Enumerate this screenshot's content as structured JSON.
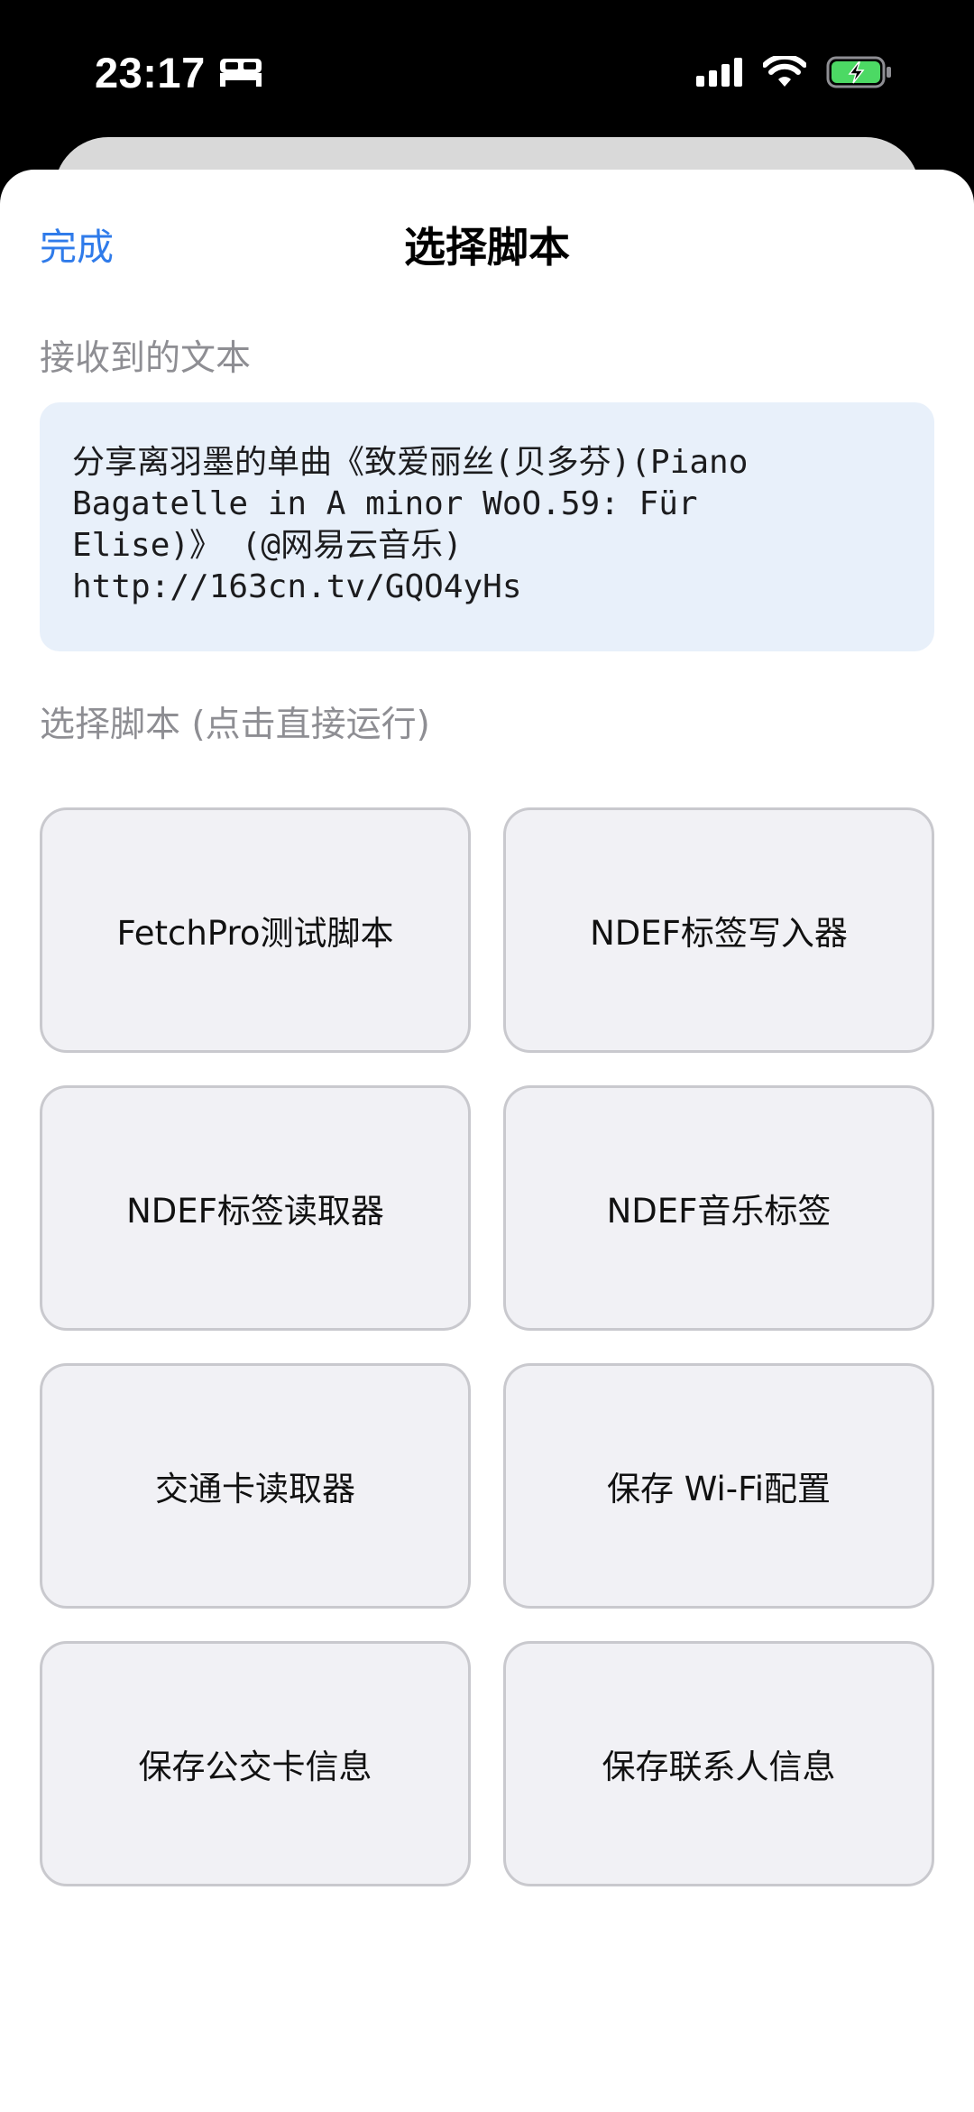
{
  "status_bar": {
    "time": "23:17",
    "icons": [
      "bed-icon",
      "cellular-signal-icon",
      "wifi-icon",
      "battery-charging-icon"
    ],
    "battery_color": "#4cd964"
  },
  "sheet": {
    "done_label": "完成",
    "title": "选择脚本",
    "accent_color": "#2f7bea"
  },
  "received": {
    "label": "接收到的文本",
    "text": "分享离羽墨的单曲《致爱丽丝(贝多芬)(Piano\nBagatelle in A minor WoO.59: Für\nElise)》 (@网易云音乐)\nhttp://163cn.tv/GQO4yHs"
  },
  "scripts": {
    "label": "选择脚本 (点击直接运行)",
    "items": [
      {
        "label": "FetchPro测试脚本"
      },
      {
        "label": "NDEF标签写入器"
      },
      {
        "label": "NDEF标签读取器"
      },
      {
        "label": "NDEF音乐标签"
      },
      {
        "label": "交通卡读取器"
      },
      {
        "label": "保存 Wi-Fi配置"
      },
      {
        "label": "保存公交卡信息"
      },
      {
        "label": "保存联系人信息"
      }
    ]
  }
}
